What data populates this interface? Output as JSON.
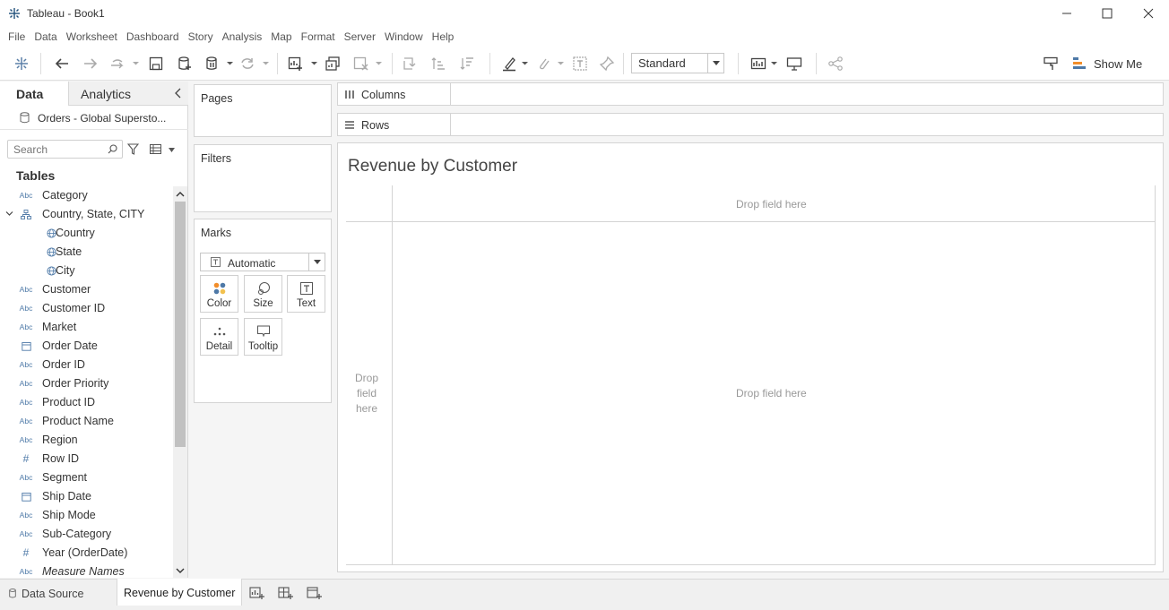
{
  "window": {
    "title": "Tableau - Book1"
  },
  "menu": [
    "File",
    "Data",
    "Worksheet",
    "Dashboard",
    "Story",
    "Analysis",
    "Map",
    "Format",
    "Server",
    "Window",
    "Help"
  ],
  "toolbar": {
    "fit_value": "Standard",
    "show_me_label": "Show Me"
  },
  "data_pane": {
    "tab_data": "Data",
    "tab_analytics": "Analytics",
    "datasource_name": "Orders - Global Supersto...",
    "search_placeholder": "Search",
    "tables_heading": "Tables",
    "fields": [
      {
        "type": "Abc",
        "name": "Category"
      },
      {
        "type": "hierarchy",
        "name": "Country, State, CITY"
      },
      {
        "type": "geo",
        "name": "Country"
      },
      {
        "type": "geo",
        "name": "State"
      },
      {
        "type": "geo",
        "name": "City"
      },
      {
        "type": "Abc",
        "name": "Customer"
      },
      {
        "type": "Abc",
        "name": "Customer ID"
      },
      {
        "type": "Abc",
        "name": "Market"
      },
      {
        "type": "date",
        "name": "Order Date"
      },
      {
        "type": "Abc",
        "name": "Order ID"
      },
      {
        "type": "Abc",
        "name": "Order Priority"
      },
      {
        "type": "Abc",
        "name": "Product ID"
      },
      {
        "type": "Abc",
        "name": "Product Name"
      },
      {
        "type": "Abc",
        "name": "Region"
      },
      {
        "type": "#",
        "name": "Row ID"
      },
      {
        "type": "Abc",
        "name": "Segment"
      },
      {
        "type": "date",
        "name": "Ship Date"
      },
      {
        "type": "Abc",
        "name": "Ship Mode"
      },
      {
        "type": "Abc",
        "name": "Sub-Category"
      },
      {
        "type": "#",
        "name": "Year (OrderDate)"
      },
      {
        "type": "Abc",
        "name": "Measure Names"
      }
    ]
  },
  "shelves": {
    "pages": "Pages",
    "filters": "Filters",
    "marks": "Marks",
    "mark_type": "Automatic",
    "mark_buttons": [
      "Color",
      "Size",
      "Text",
      "Detail",
      "Tooltip"
    ],
    "columns": "Columns",
    "rows": "Rows"
  },
  "canvas": {
    "sheet_title": "Revenue by Customer",
    "drop_columns": "Drop field here",
    "drop_body": "Drop field here",
    "drop_rows": "Drop field here"
  },
  "sheet_tabs": {
    "data_source": "Data Source",
    "active_sheet": "Revenue by Customer"
  },
  "colors": {
    "accent_blue": "#4f7aa8",
    "color_mark_orange": "#f28e2b",
    "color_mark_blue": "#4e79a7"
  }
}
